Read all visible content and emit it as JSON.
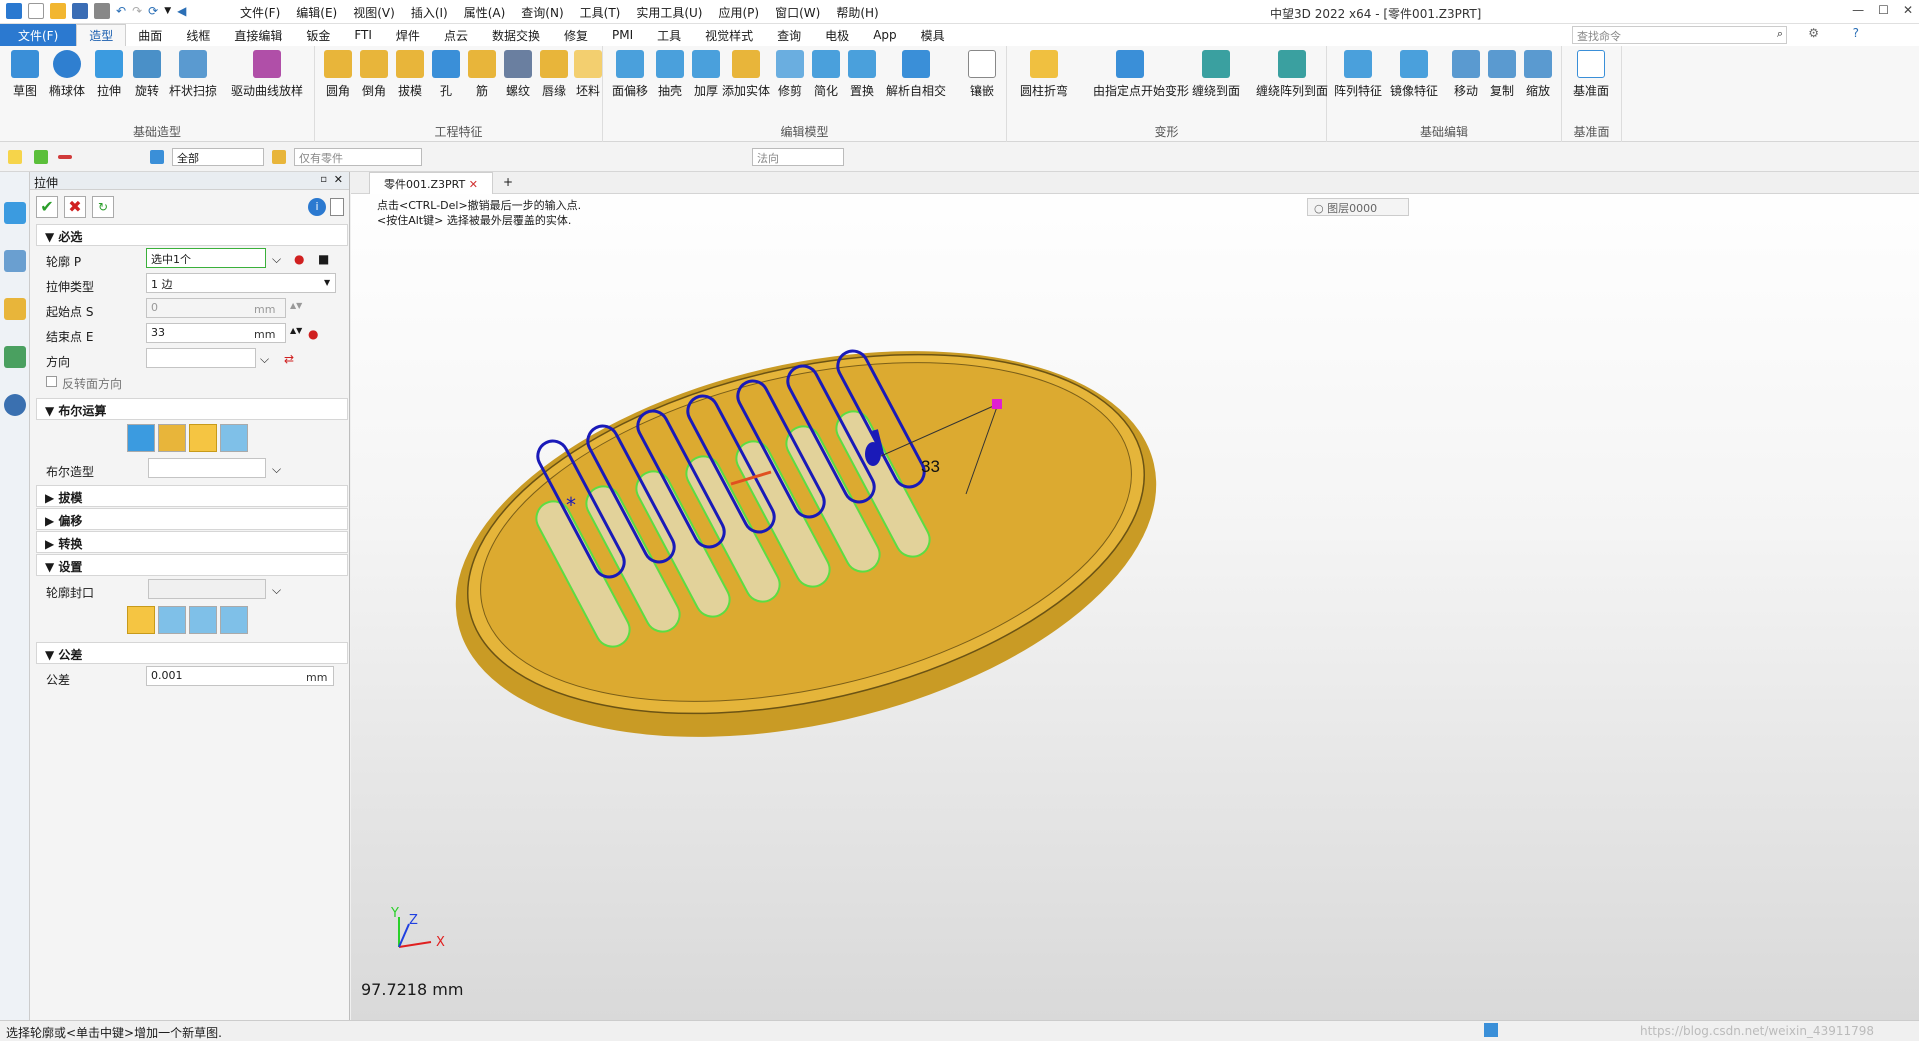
{
  "titlebar": {
    "title": "中望3D 2022 x64 - [零件001.Z3PRT]",
    "menus": [
      "文件(F)",
      "编辑(E)",
      "视图(V)",
      "插入(I)",
      "属性(A)",
      "查询(N)",
      "工具(T)",
      "实用工具(U)",
      "应用(P)",
      "窗口(W)",
      "帮助(H)"
    ]
  },
  "tabs": [
    "文件(F)",
    "造型",
    "曲面",
    "线框",
    "直接编辑",
    "钣金",
    "FTI",
    "焊件",
    "点云",
    "数据交换",
    "修复",
    "PMI",
    "工具",
    "视觉样式",
    "查询",
    "电极",
    "App",
    "模具"
  ],
  "search": {
    "placeholder": "查找命令"
  },
  "ribbon": {
    "groups": [
      {
        "name": "基础造型",
        "buttons": [
          "草图",
          "椭球体",
          "拉伸",
          "旋转",
          "杆状扫掠",
          "驱动曲线放样"
        ]
      },
      {
        "name": "工程特征",
        "buttons": [
          "圆角",
          "倒角",
          "拔模",
          "孔",
          "筋",
          "螺纹",
          "唇缘",
          "坯料"
        ]
      },
      {
        "name": "编辑模型",
        "buttons": [
          "面偏移",
          "抽壳",
          "加厚",
          "添加实体",
          "修剪",
          "简化",
          "置换",
          "解析自相交",
          "镶嵌"
        ]
      },
      {
        "name": "变形",
        "buttons": [
          "圆柱折弯",
          "由指定点开始变形",
          "缠绕到面",
          "缠绕阵列到面"
        ]
      },
      {
        "name": "基础编辑",
        "buttons": [
          "阵列特征",
          "镜像特征",
          "移动",
          "复制",
          "缩放"
        ]
      },
      {
        "name": "基准面",
        "buttons": [
          "基准面"
        ]
      }
    ]
  },
  "toolbar2": {
    "filter": "全部",
    "part_filter": "仅有零件",
    "direction": "法向"
  },
  "panel": {
    "title": "拉伸",
    "sections": {
      "required": "必选",
      "boolean": "布尔运算",
      "draft": "拔模",
      "offset": "偏移",
      "transform": "转换",
      "settings": "设置",
      "tolerance": "公差"
    },
    "profile_label": "轮廓 P",
    "profile_value": "选中1个",
    "type_label": "拉伸类型",
    "type_value": "1 边",
    "start_label": "起始点 S",
    "start_value": "0",
    "start_unit": "mm",
    "end_label": "结束点 E",
    "end_value": "33",
    "end_unit": "mm",
    "dir_label": "方向",
    "reverse_label": "反转面方向",
    "bool_shape_label": "布尔造型",
    "cap_label": "轮廓封口",
    "tol_label": "公差",
    "tol_value": "0.001",
    "tol_unit": "mm"
  },
  "viewport": {
    "doc_tab": "零件001.Z3PRT",
    "hint1": "点击<CTRL-Del>撤销最后一步的输入点.",
    "hint2": "<按住Alt键> 选择被最外层覆盖的实体.",
    "layer": "图层0000",
    "dim_label": "33",
    "distance": "97.7218 mm",
    "axis_x": "X",
    "axis_y": "Y",
    "axis_z": "Z"
  },
  "status": {
    "text": "选择轮廓或<单击中键>增加一个新草图.",
    "url": "https://blog.csdn.net/weixin_43911798"
  },
  "colors": {
    "accent": "#2b79d0",
    "body": "#e3b43b",
    "body_dark": "#b98a1a",
    "profile_blue": "#1a1ab8",
    "preview_green": "#5ae04a"
  }
}
